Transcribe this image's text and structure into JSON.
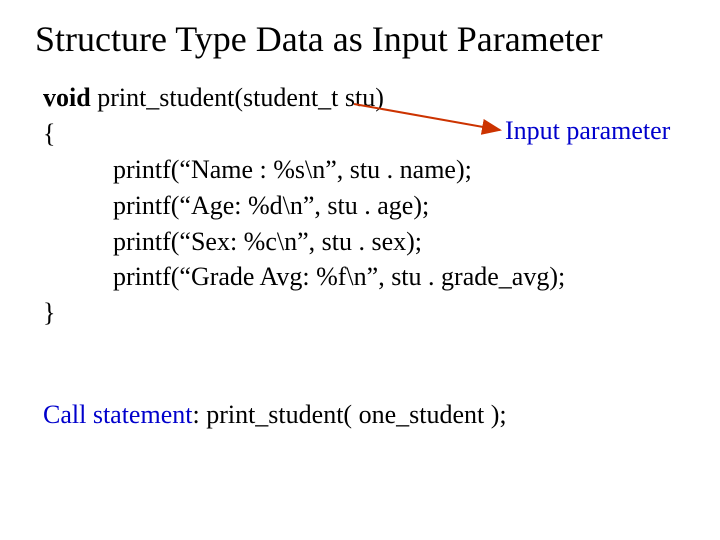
{
  "title": "Structure Type Data as Input Parameter",
  "code": {
    "sig_void": "void",
    "sig_rest": " print_student(student_t stu)",
    "open_brace": "{",
    "line1": "printf(“Name : %s\\n”, stu . name);",
    "line2": "printf(“Age: %d\\n”, stu . age);",
    "line3": "printf(“Sex: %c\\n”, stu . sex);",
    "line4": "printf(“Grade Avg: %f\\n”, stu . grade_avg);",
    "close_brace": "}"
  },
  "annotation": "Input parameter",
  "call": {
    "label": "Call statement",
    "sep": ": ",
    "code": "print_student( one_student );"
  },
  "colors": {
    "annotation": "#0000cc",
    "arrow": "#cc3300"
  }
}
